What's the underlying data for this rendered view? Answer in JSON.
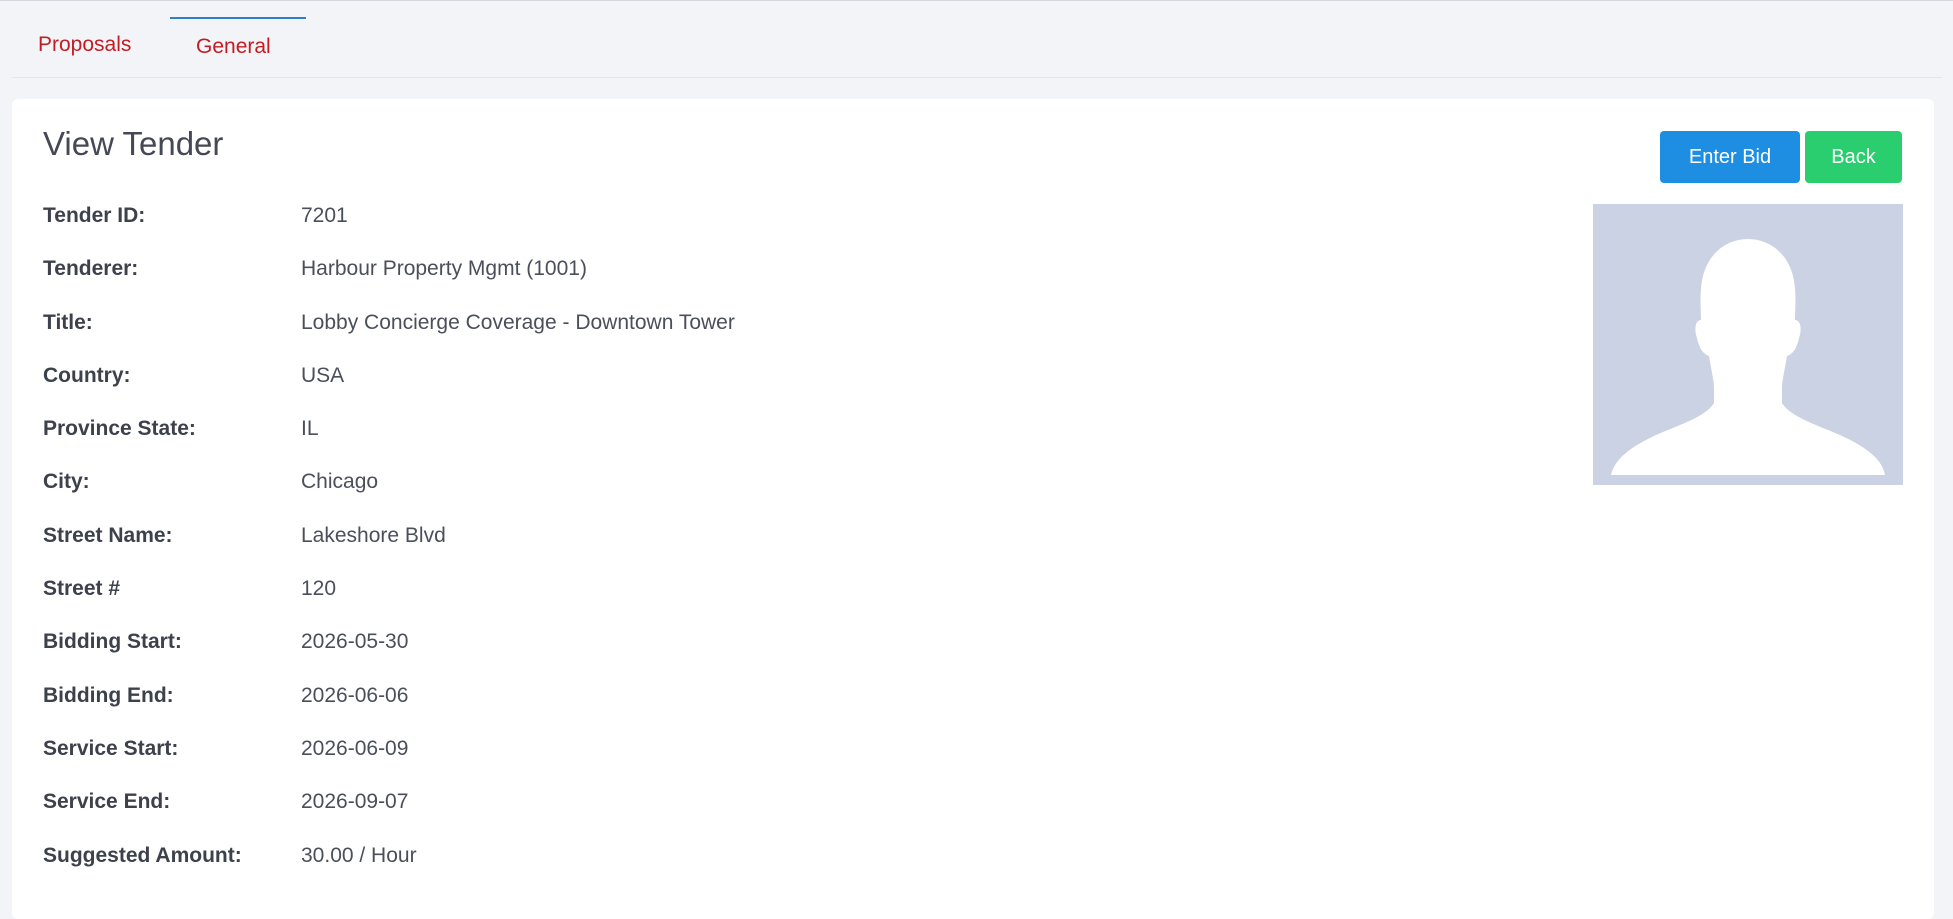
{
  "tabs": [
    {
      "label": "Proposals"
    },
    {
      "label": "General"
    }
  ],
  "page": {
    "title": "View Tender"
  },
  "actions": {
    "enter_bid_label": "Enter Bid",
    "back_label": "Back"
  },
  "details": [
    {
      "label": "Tender ID:",
      "value": "7201"
    },
    {
      "label": "Tenderer:",
      "value": "Harbour Property Mgmt (1001)"
    },
    {
      "label": "Title:",
      "value": "Lobby Concierge Coverage - Downtown Tower"
    },
    {
      "label": "Country:",
      "value": "USA"
    },
    {
      "label": "Province State:",
      "value": "IL"
    },
    {
      "label": "City:",
      "value": "Chicago"
    },
    {
      "label": "Street Name:",
      "value": "Lakeshore Blvd"
    },
    {
      "label": "Street #",
      "value": "120"
    },
    {
      "label": "Bidding Start:",
      "value": "2026-05-30"
    },
    {
      "label": "Bidding End:",
      "value": "2026-06-06"
    },
    {
      "label": "Service Start:",
      "value": "2026-06-09"
    },
    {
      "label": "Service End:",
      "value": "2026-09-07"
    },
    {
      "label": "Suggested Amount:",
      "value": "30.00 / Hour"
    }
  ],
  "avatar": {
    "icon": "person-silhouette-icon",
    "background": "#cbd2e3",
    "silhouette": "#ffffff"
  },
  "colors": {
    "tab_text": "#c21d25",
    "tab_active_indicator": "#2f7fc8",
    "enter_bid_button": "#1d8ee2",
    "back_button": "#2bce6e"
  }
}
